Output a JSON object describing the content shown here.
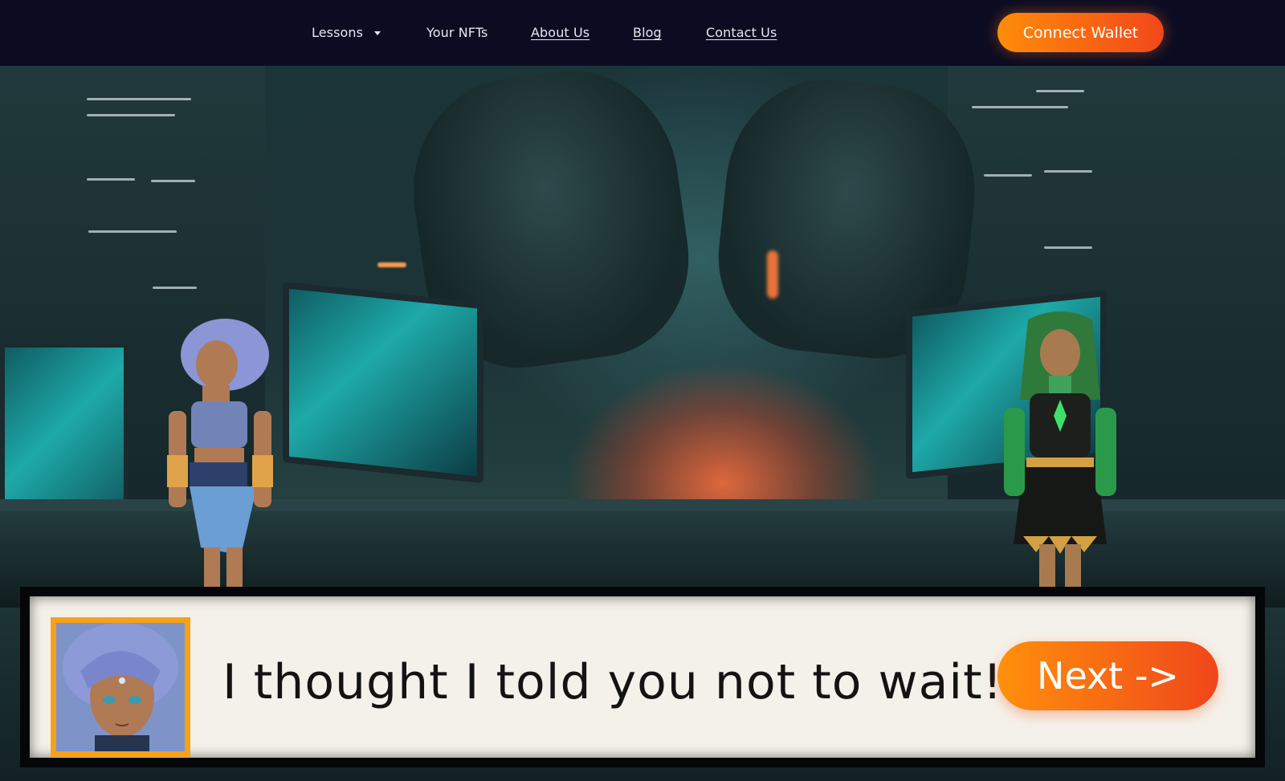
{
  "nav": {
    "lessons_label": "Lessons",
    "nfts_label": "Your NFTs",
    "about_label": "About Us",
    "blog_label": "Blog",
    "contact_label": "Contact Us",
    "wallet_button": "Connect Wallet"
  },
  "dialog": {
    "text": "I thought I told you not to wait!",
    "next_button": "Next ->"
  },
  "colors": {
    "nav_bg": "#0b0c22",
    "accent_start": "#ff8c0a",
    "accent_end": "#f2471a",
    "portrait_border": "#f5a11a",
    "dialog_bg": "#f4f1ea"
  },
  "icons": {
    "lessons_dropdown": "caret-down-icon"
  }
}
